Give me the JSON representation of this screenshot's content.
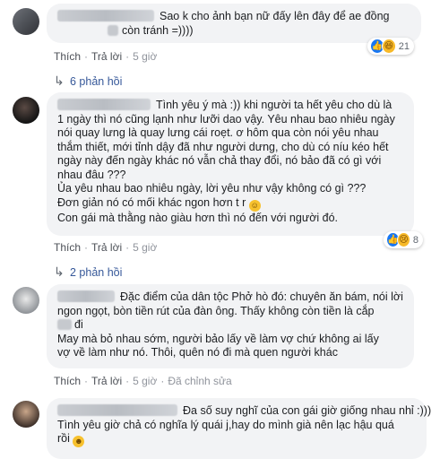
{
  "comments": [
    {
      "lines": [
        "Sao k cho ảnh bạn nữ đấy lên đây để ae đồng",
        "còn tránh =))))"
      ],
      "reactions": {
        "count": "21",
        "icons": [
          "like-icon",
          "haha-icon"
        ]
      },
      "actions": {
        "like": "Thích",
        "reply": "Trả lời",
        "time": "5 giờ"
      },
      "replies_label": "6 phản hồi"
    },
    {
      "lines": [
        "Tình yêu ý mà :)) khi người ta hết yêu cho dù là",
        "1 ngày thì nó cũng lạnh như lưỡi dao vậy. Yêu nhau bao nhiêu ngày",
        "nói quay lưng là quay lưng cái roẹt. ơ hôm qua còn nói yêu nhau",
        "thắm thiết, mới tỉnh dậy đã như người dưng, cho dù có níu kéo hết",
        "ngày này đến ngày khác nó vẫn chả thay đổi, nó bảo đã có gì với",
        "nhau đâu ???",
        "Ủa yêu nhau bao nhiêu ngày, lời yêu như vậy không có gì ???",
        "Đơn giản nó có mối khác ngon hơn t r",
        "Con gái mà thằng nào giàu hơn thì nó đến với người đó."
      ],
      "reactions": {
        "count": "8",
        "icons": [
          "like-icon",
          "sad-icon"
        ]
      },
      "actions": {
        "like": "Thích",
        "reply": "Trả lời",
        "time": "5 giờ"
      },
      "replies_label": "2 phản hồi"
    },
    {
      "lines": [
        "Đặc điểm của dân tộc Phở hò đó: chuyên ăn bám, nói lời",
        "ngon ngọt, bòn tiền rút của đàn ông. Thấy không còn tiền là cắp",
        "đi",
        "May mà bỏ nhau sớm, người bảo lấy về làm vợ chứ không ai lấy",
        "vợ về làm như nó. Thôi, quên nó đi mà quen người khác"
      ],
      "actions": {
        "like": "Thích",
        "reply": "Trả lời",
        "time": "5 giờ",
        "edited": "Đã chỉnh sửa"
      }
    },
    {
      "lines": [
        "Đa số suy nghĩ của con gái giờ giống nhau nhỉ :)))",
        "Tình yêu giờ chả có nghĩa lý quái j,hay do mình già nên lạc hậu quá",
        "rồi"
      ]
    }
  ]
}
